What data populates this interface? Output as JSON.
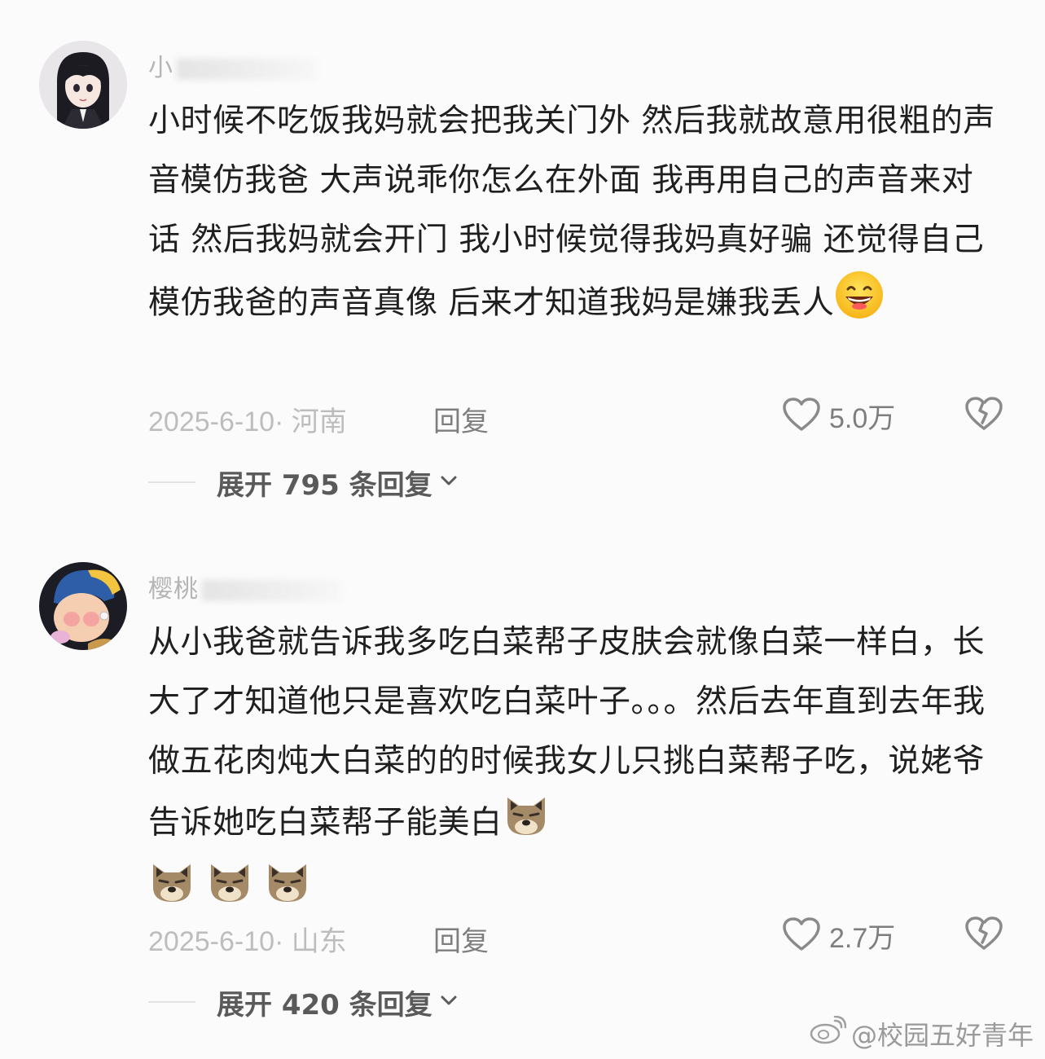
{
  "comments": [
    {
      "username": "小",
      "text": "小时候不吃饭我妈就会把我关门外 然后我就故意用很粗的声音模仿我爸 大声说乖你怎么在外面 我再用自己的声音来对话 然后我妈就会开门 我小时候觉得我妈真好骗 还觉得自己模仿我爸的声音真像 后来才知道我妈是嫌我丢人",
      "emoji": [
        "grinning-face"
      ],
      "date": "2025-6-10· 河南",
      "reply_label": "回复",
      "likes": "5.0万",
      "expand_label": "展开 795 条回复"
    },
    {
      "username": "樱桃",
      "text": "从小我爸就告诉我多吃白菜帮子皮肤会就像白菜一样白，长大了才知道他只是喜欢吃白菜叶子。。。然后去年直到去年我做五花肉炖大白菜的的时候我女儿只挑白菜帮子吃，说姥爷告诉她吃白菜帮子能美白",
      "emoji": [
        "dog-face",
        "dog-face",
        "dog-face",
        "dog-face"
      ],
      "date": "2025-6-10· 山东",
      "reply_label": "回复",
      "likes": "2.7万",
      "expand_label": "展开 420 条回复"
    }
  ],
  "watermark": "@校园五好青年",
  "colors": {
    "background": "#fbfbfb",
    "text": "#1f1f1f",
    "meta": "#bdbdbd",
    "action": "#7e7e7e"
  }
}
